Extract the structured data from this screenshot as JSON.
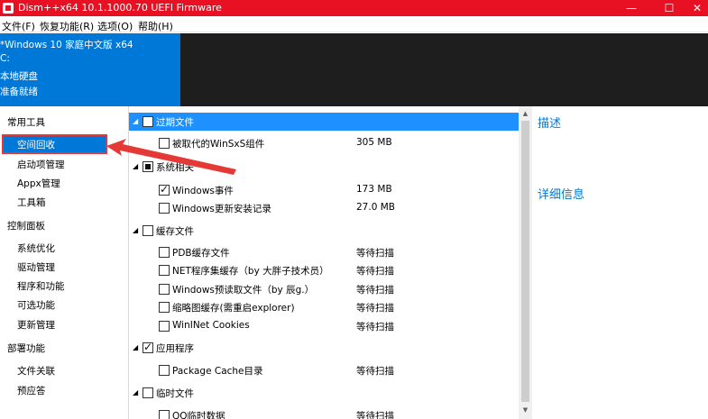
{
  "window": {
    "title": "Dism++x64 10.1.1000.70 UEFI Firmware",
    "controls": {
      "minimize": "—",
      "maximize": "☐",
      "close": "✕"
    }
  },
  "menu": [
    "文件(F)",
    "恢复功能(R)",
    "选项(O)",
    "帮助(H)"
  ],
  "info_panel": {
    "os": "*Windows 10 家庭中文版 x64",
    "drive": "C:",
    "disk": "本地硬盘",
    "status": "准备就绪"
  },
  "sidebar": {
    "groups": [
      {
        "title": "常用工具",
        "items": [
          "空间回收",
          "启动项管理",
          "Appx管理",
          "工具箱"
        ]
      },
      {
        "title": "控制面板",
        "items": [
          "系统优化",
          "驱动管理",
          "程序和功能",
          "可选功能",
          "更新管理"
        ]
      },
      {
        "title": "部署功能",
        "items": [
          "文件关联",
          "预应答"
        ]
      }
    ],
    "selected": "空间回收"
  },
  "tree": {
    "groups": [
      {
        "label": "过期文件",
        "state": "unchecked",
        "highlight": true,
        "items": [
          {
            "label": "被取代的WinSxS组件",
            "size": "305 MB",
            "checked": false
          }
        ]
      },
      {
        "label": "系统相关",
        "state": "partial",
        "highlight": false,
        "items": [
          {
            "label": "Windows事件",
            "size": "173 MB",
            "checked": true
          },
          {
            "label": "Windows更新安装记录",
            "size": "27.0 MB",
            "checked": false
          }
        ]
      },
      {
        "label": "缓存文件",
        "state": "unchecked",
        "highlight": false,
        "items": [
          {
            "label": "PDB缓存文件",
            "size": "等待扫描",
            "checked": false
          },
          {
            "label": "NET程序集缓存（by 大胖子技术员）",
            "size": "等待扫描",
            "checked": false
          },
          {
            "label": "Windows预读取文件（by 辰g.）",
            "size": "等待扫描",
            "checked": false
          },
          {
            "label": "缩略图缓存(需重启explorer)",
            "size": "等待扫描",
            "checked": false
          },
          {
            "label": "WinINet Cookies",
            "size": "等待扫描",
            "checked": false
          }
        ]
      },
      {
        "label": "应用程序",
        "state": "checked",
        "highlight": false,
        "items": [
          {
            "label": "Package Cache目录",
            "size": "等待扫描",
            "checked": false
          }
        ]
      },
      {
        "label": "临时文件",
        "state": "unchecked",
        "highlight": false,
        "items": [
          {
            "label": "QQ临时数据",
            "size": "等待扫描",
            "checked": false
          }
        ]
      }
    ]
  },
  "right_panel": {
    "description_title": "描述",
    "details_title": "详细信息"
  },
  "colors": {
    "titlebar": "#e81123",
    "accent": "#0078d7",
    "highlight_row": "#1e90ff",
    "annotation": "#e53935"
  }
}
